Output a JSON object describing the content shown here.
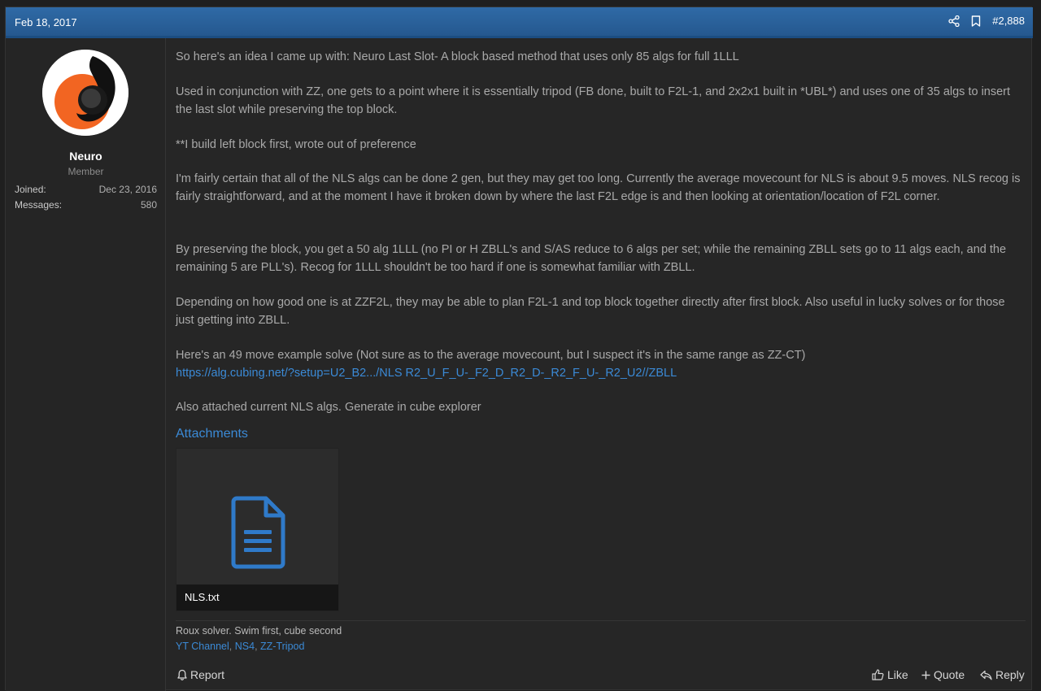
{
  "header": {
    "date": "Feb 18, 2017",
    "post_number": "#2,888",
    "icons": [
      "share-icon",
      "bookmark-icon"
    ]
  },
  "user": {
    "name": "Neuro",
    "title": "Member",
    "stats": [
      {
        "label": "Joined:",
        "value": "Dec 23, 2016"
      },
      {
        "label": "Messages:",
        "value": "580"
      }
    ]
  },
  "body": {
    "p1": "So here's an idea I came up with: Neuro Last Slot- A block based method that uses only 85 algs for full 1LLL",
    "p2": "Used in conjunction with ZZ, one gets to a point where it is essentially tripod (FB done, built to F2L-1, and 2x2x1 built in *UBL*) and uses one of 35 algs to insert the last slot while preserving the top block.",
    "p3": "**I build left block first, wrote out of preference",
    "p4": "I'm fairly certain that all of the NLS algs can be done 2 gen, but they may get too long. Currently the average movecount for NLS is about 9.5 moves. NLS recog is fairly straightforward, and at the moment I have it broken down by where the last F2L edge is and then looking at orientation/location of F2L corner.",
    "p5": "By preserving the block, you get a 50 alg 1LLL (no PI or H ZBLL's and S/AS reduce to 6 algs per set; while the remaining ZBLL sets go to 11 algs each, and the remaining 5 are PLL's). Recog for 1LLL shouldn't be too hard if one is somewhat familiar with ZBLL.",
    "p6": "Depending on how good one is at ZZF2L, they may be able to plan F2L-1 and top block together directly after first block. Also useful in lucky solves or for those just getting into ZBLL.",
    "p7": "Here's an 49 move example solve (Not sure as to the average movecount, but I suspect it's in the same range as ZZ-CT)",
    "link": "https://alg.cubing.net/?setup=U2_B2.../NLS R2_U_F_U-_F2_D_R2_D-_R2_F_U-_R2_U2//ZBLL",
    "p8": "Also attached current NLS algs. Generate in cube explorer"
  },
  "attachments": {
    "title": "Attachments",
    "file_name": "NLS.txt",
    "icon": "file-text-icon"
  },
  "signature": {
    "line1": "Roux solver. Swim first, cube second",
    "links": [
      "YT Channel",
      "NS4",
      "ZZ-Tripod"
    ],
    "separator": ", "
  },
  "actions": {
    "report": "Report",
    "like": "Like",
    "quote": "Quote",
    "reply": "Reply"
  },
  "colors": {
    "header_bg": "#2a629c",
    "link": "#3b8ad6",
    "avatar_orange": "#f26522"
  }
}
